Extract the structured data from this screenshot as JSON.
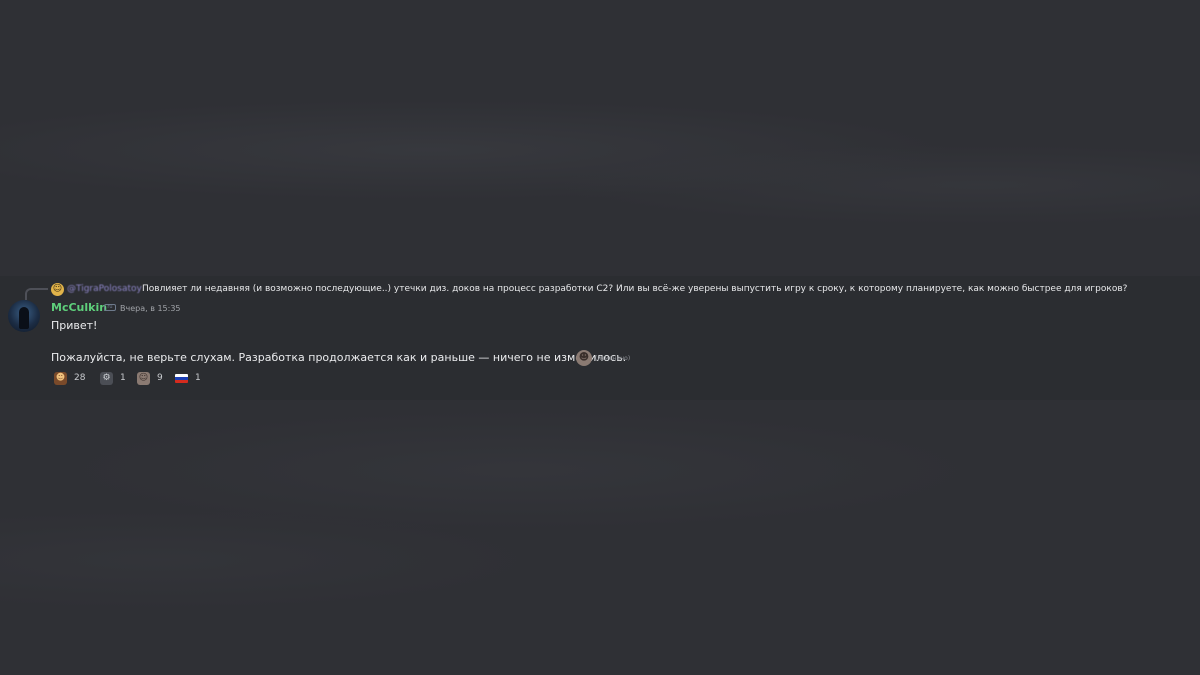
{
  "reply": {
    "avatar_icon": "emoji-face-icon",
    "handle": "@TigraPolosatoy",
    "text": "Повлияет ли недавняя (и возможно последующие..) утечки диз. доков на процесс разработки С2? Или вы всё-же уверены выпустить игру к сроку, к которому планируете, как можно быстрее для игроков?"
  },
  "message": {
    "author": "McCulkin",
    "author_color": "#5ecf7b",
    "badge_icon": "server-badge-icon",
    "badge_text": "ru",
    "timestamp": "Вчера, в 15:35",
    "lines": [
      "Привет!",
      "Пожалуйста, не верьте слухам. Разработка продолжается как и раньше — ничего не изменилось."
    ],
    "inline_emoji": "person-emoji-icon",
    "edited_label": "(изменено)"
  },
  "reactions": [
    {
      "icon": "brown-character-emoji",
      "count": "28"
    },
    {
      "icon": "robot-emoji",
      "count": "1"
    },
    {
      "icon": "person-emoji",
      "count": "9"
    },
    {
      "icon": "russia-flag-emoji",
      "count": "1"
    }
  ]
}
